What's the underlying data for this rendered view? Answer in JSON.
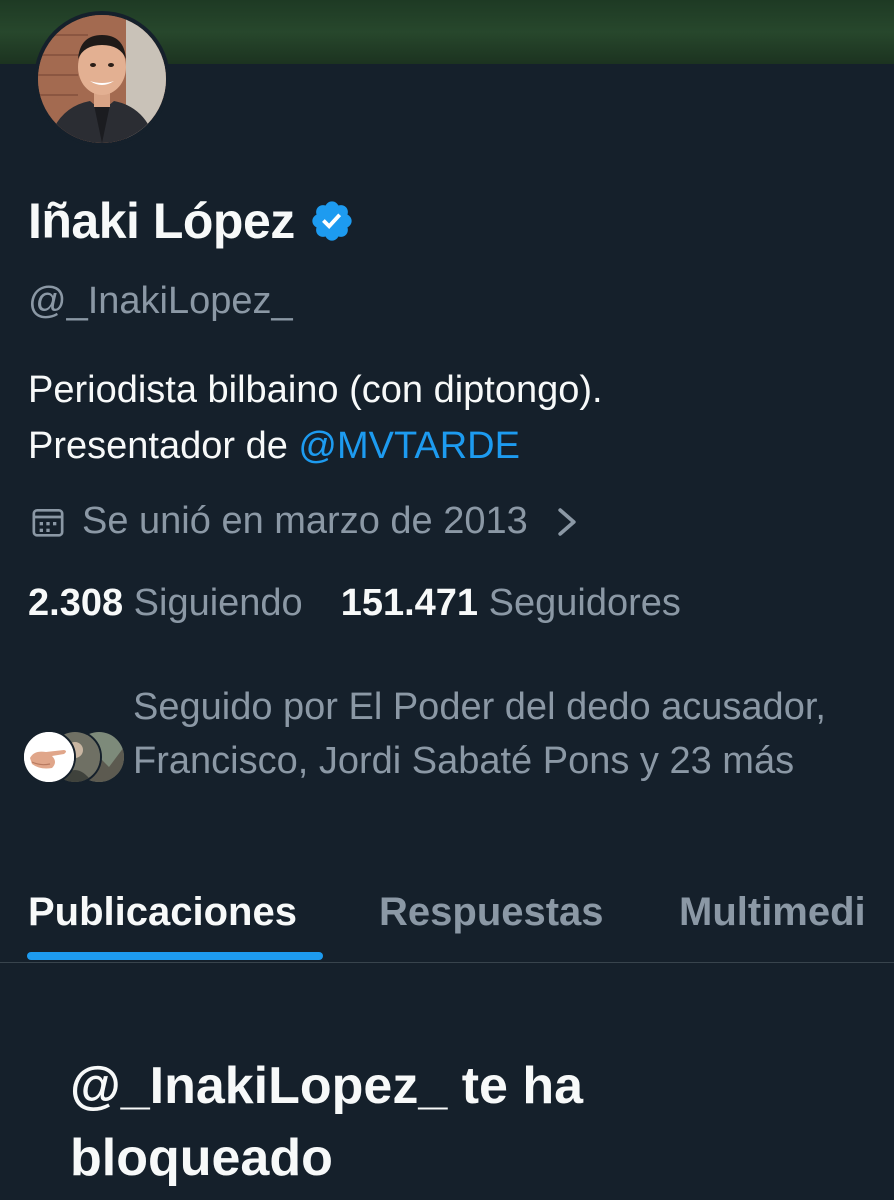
{
  "profile": {
    "display_name": "Iñaki López",
    "verified_icon": "verified-badge-icon",
    "handle": "@_InakiLopez_",
    "bio_line1": "Periodista bilbaino (con diptongo).",
    "bio_line2_prefix": "Presentador de ",
    "bio_mention": "@MVTARDE",
    "joined": "Se unió en marzo de 2013",
    "following_count": "2.308",
    "following_label": "Siguiendo",
    "followers_count": "151.471",
    "followers_label": "Seguidores",
    "followed_by": "Seguido por El Poder del dedo acusador, Francisco, Jordi Sabaté Pons y 23 más"
  },
  "tabs": [
    {
      "label": "Publicaciones",
      "active": true
    },
    {
      "label": "Respuestas",
      "active": false
    },
    {
      "label": "Multimedi",
      "active": false
    }
  ],
  "blocked_message": "@_InakiLopez_ te ha bloqueado",
  "colors": {
    "background": "#15202b",
    "accent": "#1d9bf0",
    "text_primary": "#f7f9f9",
    "text_secondary": "#8b98a5",
    "divider": "#38444d"
  },
  "icons": [
    "calendar-icon",
    "chevron-right-icon",
    "verified-badge-icon"
  ]
}
